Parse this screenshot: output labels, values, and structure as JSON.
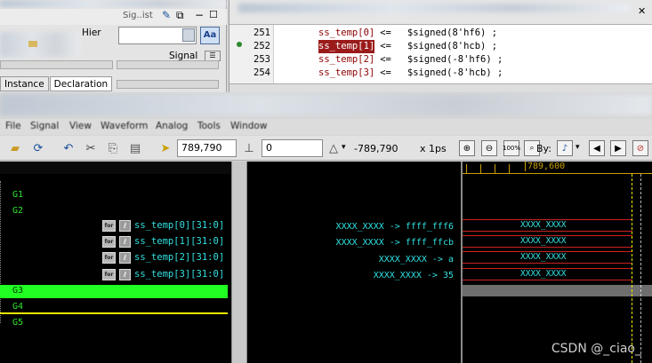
{
  "hier_panel": {
    "header_label": "Hier",
    "signal_label": "Signal",
    "tabs": [
      "Instance",
      "Declaration"
    ]
  },
  "source": {
    "lines": [
      {
        "num": "251",
        "lhs": "ss_temp[0]",
        "op": "<=",
        "rhs": "$signed(8'hf6) ;"
      },
      {
        "num": "252",
        "lhs": "ss_temp[1]",
        "op": "<=",
        "rhs": "$signed(8'hcb) ;"
      },
      {
        "num": "253",
        "lhs": "ss_temp[2]",
        "op": "<=",
        "rhs": "$signed(-8'hf6) ;"
      },
      {
        "num": "254",
        "lhs": "ss_temp[3]",
        "op": "<=",
        "rhs": "$signed(-8'hcb) ;"
      }
    ]
  },
  "menu": [
    "File",
    "Signal",
    "View",
    "Waveform",
    "Analog",
    "Tools",
    "Window"
  ],
  "toolbar": {
    "cursor_time": "789,790",
    "marker_time": "0",
    "delta_time": "-789,790",
    "time_scale": "x 1ps",
    "by_label": "By:",
    "zoom_fit_label": "100%"
  },
  "timeline": {
    "tick_label": "789,600"
  },
  "groups": [
    {
      "id": "G1",
      "label": "G1"
    },
    {
      "id": "G2",
      "label": "G2"
    },
    {
      "id": "G3",
      "label": "G3"
    },
    {
      "id": "G4",
      "label": "G4"
    },
    {
      "id": "G5",
      "label": "G5"
    }
  ],
  "signals": [
    {
      "name": "ss_temp[0][31:0]",
      "value": "XXXX_XXXX -> ffff_fff6",
      "wave": "XXXX_XXXX"
    },
    {
      "name": "ss_temp[1][31:0]",
      "value": "XXXX_XXXX -> ffff_ffcb",
      "wave": "XXXX_XXXX"
    },
    {
      "name": "ss_temp[2][31:0]",
      "value": "XXXX_XXXX -> a",
      "wave": "XXXX_XXXX"
    },
    {
      "name": "ss_temp[3][31:0]",
      "value": "XXXX_XXXX -> 35",
      "wave": "XXXX_XXXX"
    }
  ],
  "watermark": "CSDN @_ciao_",
  "colors": {
    "signal_text": "#33e0e0",
    "group_text": "#2ee62e",
    "selected_row": "#22ff22",
    "highlight_line": "#e8e800",
    "bus_edge": "#cc2222",
    "source_highlight": "#9b1b1b"
  }
}
